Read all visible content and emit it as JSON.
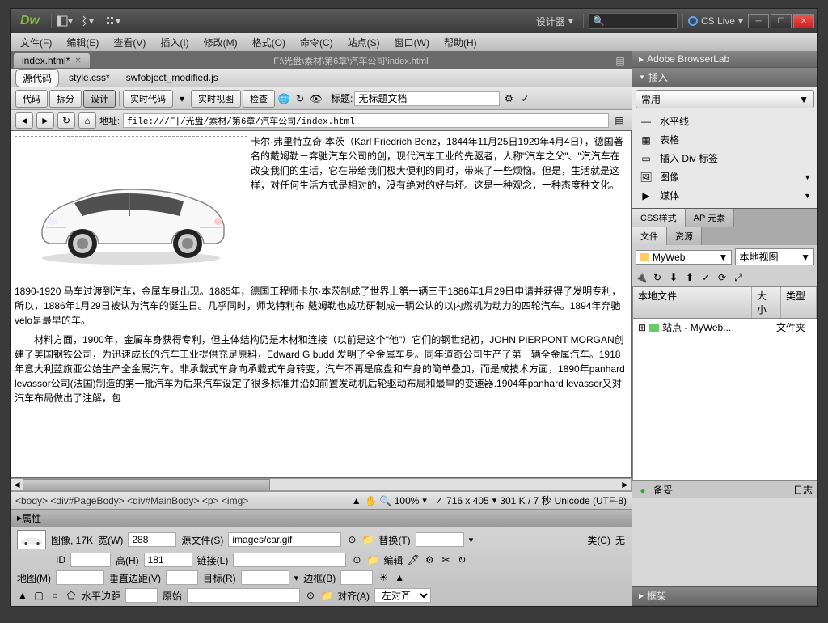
{
  "titlebar": {
    "logo": "Dw",
    "designer": "设计器",
    "cslive": "CS Live"
  },
  "menu": [
    "文件(F)",
    "编辑(E)",
    "查看(V)",
    "插入(I)",
    "修改(M)",
    "格式(O)",
    "命令(C)",
    "站点(S)",
    "窗口(W)",
    "帮助(H)"
  ],
  "doc": {
    "tab": "index.html*",
    "path": "F:\\光盘\\素材\\第6章\\汽车公司\\index.html"
  },
  "src_tabs": {
    "active": "源代码",
    "items": [
      "源代码",
      "style.css*",
      "swfobject_modified.js"
    ]
  },
  "view": {
    "code": "代码",
    "split": "拆分",
    "design": "设计",
    "live": "实时代码",
    "liveview": "实时视图",
    "inspect": "检查",
    "title_label": "标题:",
    "title_value": "无标题文档"
  },
  "addr": {
    "label": "地址:",
    "value": "file:///F|/光盘/素材/第6章/汽车公司/index.html"
  },
  "content": {
    "p1": "卡尔·弗里特立奇·本茨（Karl Friedrich Benz，1844年11月25日1929年4月4日），德国著名的戴姆勒－奔驰汽车公司的创，现代汽车工业的先驱者，人称\"汽车之父\"、\"汽汽车在改变我们的生活，它在带给我们极大便利的同时，带来了一些烦恼。但是，生活就是这样，对任何生活方式是相对的，没有绝对的好与坏。这是一种观念，一种态度种文化。",
    "p2": "1890-1920 马车过渡到汽车，金属车身出现。1885年，德国工程师卡尔·本茨制成了世界上第一辆三于1886年1月29日申请并获得了发明专利，所以，1886年1月29日被认为汽车的诞生日。几乎同时，师戈特利布·戴姆勒也成功研制成一辆公认的以内燃机为动力的四轮汽车。1894年奔驰velo是最早的车。",
    "p3": "材料方面，1900年，金属车身获得专利，但主体结构仍是木材和连接（以前是这个\"他\"）它们的钢世纪初，JOHN PIERPONT MORGAN创建了美国钢铁公司，为迅速成长的汽车工业提供充足原料，Edward G budd 发明了全金属车身。同年道奇公司生产了第一辆全金属汽车。1918年意大利蓝旗亚公始生产全金属汽车。非承载式车身向承载式车身转变，汽车不再是底盘和车身的简单叠加，而是成技术方面，1890年panhard levassor公司(法国)制造的第一批汽车为后来汽车设定了很多标准并沿如前置发动机后轮驱动布局和最早的变速器.1904年panhard levassor又对汽车布局做出了注解，包"
  },
  "status": {
    "tags": [
      "<body>",
      "<div#PageBody>",
      "<div#MainBody>",
      "<p>",
      "<img>"
    ],
    "zoom": "100%",
    "dims": "716 x 405",
    "size": "301 K / 7 秒",
    "encoding": "Unicode (UTF-8)"
  },
  "props": {
    "header": "属性",
    "img_label": "图像, 17K",
    "width_label": "宽(W)",
    "width": "288",
    "height_label": "高(H)",
    "height": "181",
    "src_label": "源文件(S)",
    "src": "images/car.gif",
    "link_label": "链接(L)",
    "alt_label": "替换(T)",
    "id_label": "ID",
    "class_label": "类(C)",
    "class_value": "无",
    "map_label": "地图(M)",
    "vspace_label": "垂直边距(V)",
    "target_label": "目标(R)",
    "border_label": "边框(B)",
    "hspace_label": "水平边距",
    "orig_label": "原始",
    "align_label": "对齐(A)",
    "align_value": "左对齐",
    "edit_label": "编辑"
  },
  "panels": {
    "browserlab": "Adobe BrowserLab",
    "insert": "插入",
    "insert_cat": "常用",
    "insert_items": [
      "水平线",
      "表格",
      "插入 Div 标签",
      "图像",
      "媒体"
    ],
    "css": "CSS样式",
    "ap": "AP 元素",
    "files": "文件",
    "assets": "资源",
    "site": "MyWeb",
    "view": "本地视图",
    "tree_headers": [
      "本地文件",
      "大小",
      "类型"
    ],
    "tree_row": "站点 - MyWeb...",
    "tree_type": "文件夹",
    "backup": "备妥",
    "log": "日志",
    "frame": "框架"
  }
}
